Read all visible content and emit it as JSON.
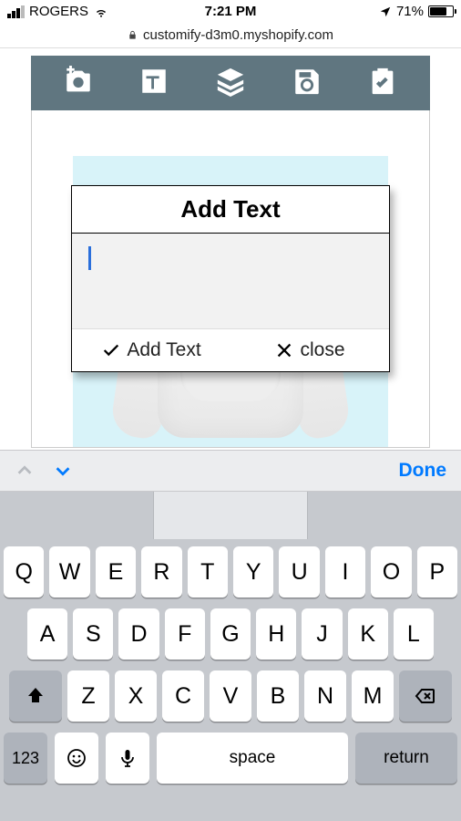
{
  "status": {
    "carrier": "ROGERS",
    "time": "7:21 PM",
    "battery_pct": "71%"
  },
  "address": {
    "host": "customify-d3m0.myshopify.com"
  },
  "toolbar": {
    "icons": [
      "add-image-icon",
      "text-icon",
      "layers-icon",
      "save-icon",
      "checklist-icon"
    ]
  },
  "modal": {
    "title": "Add Text",
    "input_value": "",
    "add_label": "Add Text",
    "close_label": "close"
  },
  "kb_toolbar": {
    "done_label": "Done"
  },
  "keyboard": {
    "row1": [
      "Q",
      "W",
      "E",
      "R",
      "T",
      "Y",
      "U",
      "I",
      "O",
      "P"
    ],
    "row2": [
      "A",
      "S",
      "D",
      "F",
      "G",
      "H",
      "J",
      "K",
      "L"
    ],
    "row3": [
      "Z",
      "X",
      "C",
      "V",
      "B",
      "N",
      "M"
    ],
    "num_label": "123",
    "space_label": "space",
    "return_label": "return"
  }
}
